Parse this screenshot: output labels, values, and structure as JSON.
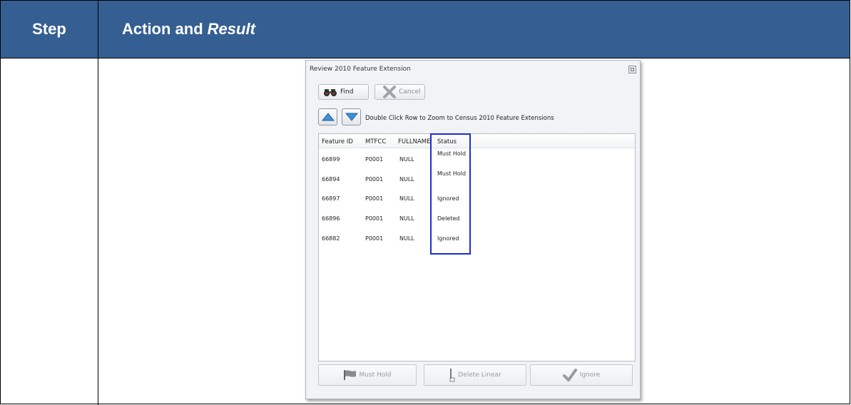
{
  "table": {
    "header_step": "Step",
    "header_action": "Action and",
    "header_result": "Result"
  },
  "colors": {
    "header_bg": "#355f93",
    "highlight_box": "#1b2fcf"
  },
  "dialog": {
    "title": "Review 2010 Feature Extension",
    "find_label": "Find",
    "cancel_label": "Cancel",
    "hint": "Double Click Row to Zoom to Census 2010 Feature Extensions",
    "columns": [
      "Feature ID",
      "MTFCC",
      "FULLNAME",
      "Status"
    ],
    "rows": [
      {
        "id": "66899",
        "mtfcc": "P0001",
        "fullname": "NULL",
        "status": "Must Hold"
      },
      {
        "id": "66894",
        "mtfcc": "P0001",
        "fullname": "NULL",
        "status": "Must Hold"
      },
      {
        "id": "66897",
        "mtfcc": "P0001",
        "fullname": "NULL",
        "status": "Ignored"
      },
      {
        "id": "66896",
        "mtfcc": "P0001",
        "fullname": "NULL",
        "status": "Deleted"
      },
      {
        "id": "66882",
        "mtfcc": "P0001",
        "fullname": "NULL",
        "status": "Ignored"
      }
    ],
    "must_hold_label": "Must Hold",
    "delete_linear_label": "Delete Linear",
    "ignore_label": "Ignore",
    "icons": {
      "find": "binoculars-icon",
      "cancel": "x-icon",
      "up": "triangle-up-icon",
      "down": "triangle-down-icon",
      "must_hold": "flag-icon",
      "delete_linear": "delete-line-icon",
      "ignore": "checkmark-icon"
    }
  }
}
